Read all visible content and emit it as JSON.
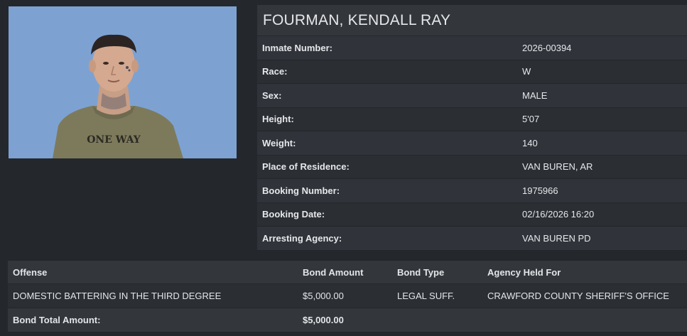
{
  "inmate": {
    "name": "FOURMAN, KENDALL RAY",
    "shirt_text": "ONE WAY",
    "details": [
      {
        "label": "Inmate Number:",
        "value": "2026-00394"
      },
      {
        "label": "Race:",
        "value": "W"
      },
      {
        "label": "Sex:",
        "value": "MALE"
      },
      {
        "label": "Height:",
        "value": "5'07"
      },
      {
        "label": "Weight:",
        "value": "140"
      },
      {
        "label": "Place of Residence:",
        "value": "VAN BUREN, AR"
      },
      {
        "label": "Booking Number:",
        "value": "1975966"
      },
      {
        "label": "Booking Date:",
        "value": "02/16/2026 16:20"
      },
      {
        "label": "Arresting Agency:",
        "value": "VAN BUREN PD"
      }
    ]
  },
  "offenses": {
    "headers": [
      "Offense",
      "Bond Amount",
      "Bond Type",
      "Agency Held For"
    ],
    "rows": [
      {
        "offense": "DOMESTIC BATTERING IN THE THIRD DEGREE",
        "bond_amount": "$5,000.00",
        "bond_type": "LEGAL SUFF.",
        "agency": "CRAWFORD COUNTY SHERIFF'S OFFICE"
      }
    ],
    "total_label": "Bond Total Amount:",
    "total_amount": "$5,000.00"
  },
  "colors": {
    "page_bg": "#24272b",
    "header_bg": "#33373c",
    "photo_bg": "#7fa4d4"
  }
}
